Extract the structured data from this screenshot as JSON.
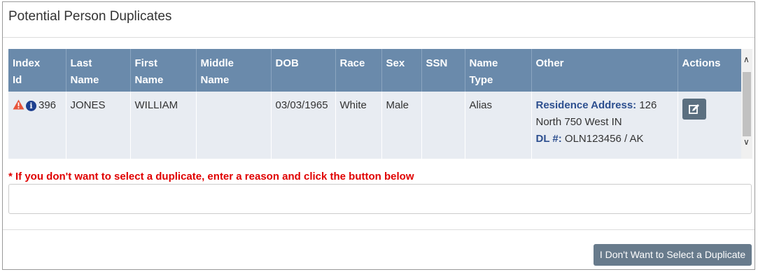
{
  "panel": {
    "title": "Potential Person Duplicates"
  },
  "table": {
    "headers": {
      "index_id": [
        "Index",
        "Id"
      ],
      "last_name": [
        "Last",
        "Name"
      ],
      "first_name": [
        "First",
        "Name"
      ],
      "middle_name": [
        "Middle",
        "Name"
      ],
      "dob": "DOB",
      "race": "Race",
      "sex": "Sex",
      "ssn": "SSN",
      "name_type": [
        "Name",
        "Type"
      ],
      "other": "Other",
      "actions": "Actions"
    },
    "rows": [
      {
        "index_id": "396",
        "last_name": "JONES",
        "first_name": "WILLIAM",
        "middle_name": "",
        "dob": "03/03/1965",
        "race": "White",
        "sex": "Male",
        "ssn": "",
        "name_type": "Alias",
        "other": {
          "residence_label": "Residence Address:",
          "residence_value": " 126 North 750 West IN",
          "dl_label": "DL #:",
          "dl_value": " OLN123456 / AK"
        },
        "icons": [
          "warning-icon",
          "info-icon",
          "edit-icon"
        ]
      }
    ]
  },
  "note": "* If you don't want to select a duplicate, enter a reason and click the button below",
  "reason_input": {
    "value": ""
  },
  "button": {
    "label": "I Don't Want to Select a Duplicate"
  },
  "colors": {
    "header_bg": "#6a8aab",
    "row_bg": "#e8ecf2",
    "note": "#e00000",
    "button_bg": "#687b8c",
    "label_blue": "#2d4f8f"
  }
}
